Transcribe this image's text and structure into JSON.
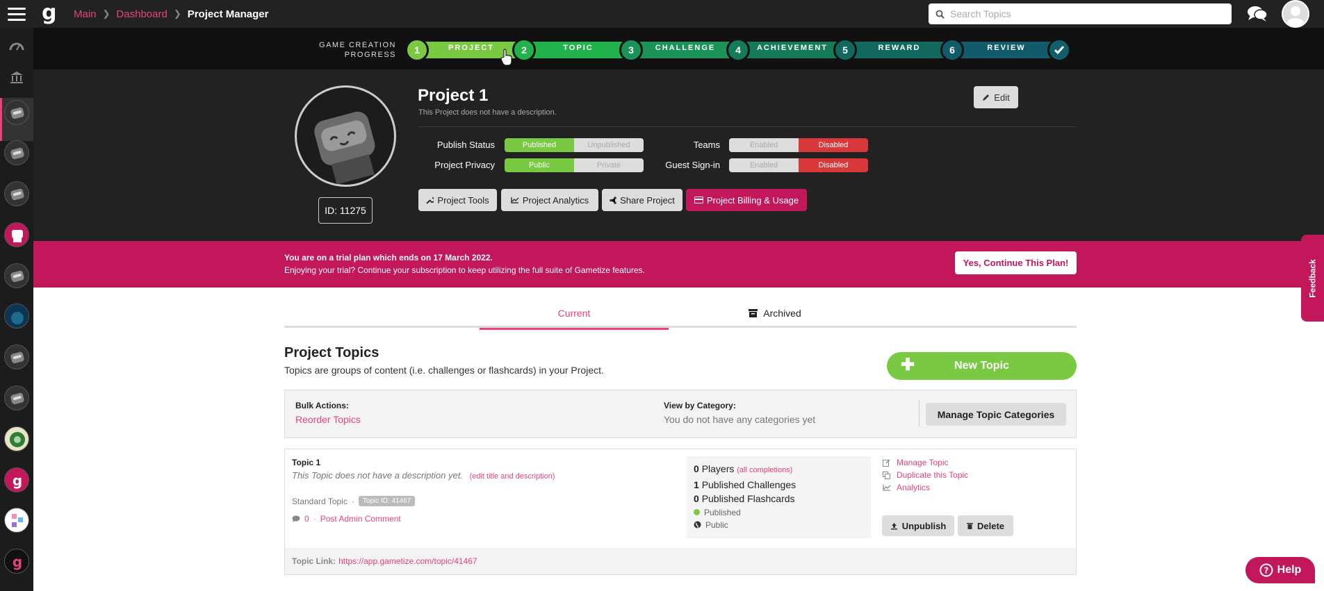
{
  "breadcrumb": {
    "main": "Main",
    "dashboard": "Dashboard",
    "current": "Project Manager"
  },
  "search": {
    "placeholder": "Search Topics"
  },
  "progress": {
    "label_line1": "GAME CREATION",
    "label_line2": "PROGRESS",
    "steps": [
      {
        "num": "1",
        "label": "PROJECT"
      },
      {
        "num": "2",
        "label": "TOPIC"
      },
      {
        "num": "3",
        "label": "CHALLENGE"
      },
      {
        "num": "4",
        "label": "ACHIEVEMENT"
      },
      {
        "num": "5",
        "label": "REWARD"
      },
      {
        "num": "6",
        "label": "REVIEW"
      }
    ],
    "colors": {
      "green": "#7ac943",
      "teal": "#1e8a5a",
      "dark_teal": "#135e6b"
    }
  },
  "project": {
    "title": "Project 1",
    "description": "This Project does not have a description.",
    "id_label": "ID: 11275",
    "edit_label": "Edit",
    "publish_status_label": "Publish Status",
    "publish_on": "Published",
    "publish_off": "Unpublished",
    "privacy_label": "Project Privacy",
    "privacy_on": "Public",
    "privacy_off": "Private",
    "teams_label": "Teams",
    "teams_off": "Enabled",
    "teams_on": "Disabled",
    "guest_label": "Guest Sign-in",
    "guest_off": "Enabled",
    "guest_on": "Disabled",
    "tools": "Project Tools",
    "analytics": "Project Analytics",
    "share": "Share Project",
    "billing": "Project Billing & Usage"
  },
  "trial": {
    "line1": "You are on a trial plan which ends on 17 March 2022.",
    "line2": "Enjoying your trial? Continue your subscription to keep utilizing the full suite of Gametize features.",
    "button": "Yes, Continue This Plan!"
  },
  "feedback": "Feedback",
  "tabs": {
    "current": "Current",
    "archived": "Archived"
  },
  "topics": {
    "title": "Project Topics",
    "subtitle": "Topics are groups of content (i.e. challenges or flashcards) in your Project.",
    "new_topic": "New Topic",
    "bulk_label": "Bulk Actions:",
    "reorder": "Reorder Topics",
    "view_label": "View by Category:",
    "view_value": "You do not have any categories yet",
    "manage_categories": "Manage Topic Categories"
  },
  "topic": {
    "name": "Topic 1",
    "description": "This Topic does not have a description yet.",
    "edit_link": "(edit title and description)",
    "type": "Standard Topic",
    "dot": "·",
    "topic_id": "Topic ID: 41467",
    "comment_count": "0",
    "post_comment": "Post Admin Comment",
    "players_num": "0",
    "players_label": "Players",
    "all_completions": "(all completions)",
    "challenges_num": "1",
    "challenges_label": "Published Challenges",
    "flashcards_num": "0",
    "flashcards_label": "Published Flashcards",
    "status": "Published",
    "privacy": "Public",
    "manage": "Manage Topic",
    "duplicate": "Duplicate this Topic",
    "analytics": "Analytics",
    "unpublish": "Unpublish",
    "delete": "Delete",
    "link_label": "Topic Link:",
    "link_url": "https://app.gametize.com/topic/41467"
  },
  "help": "Help"
}
